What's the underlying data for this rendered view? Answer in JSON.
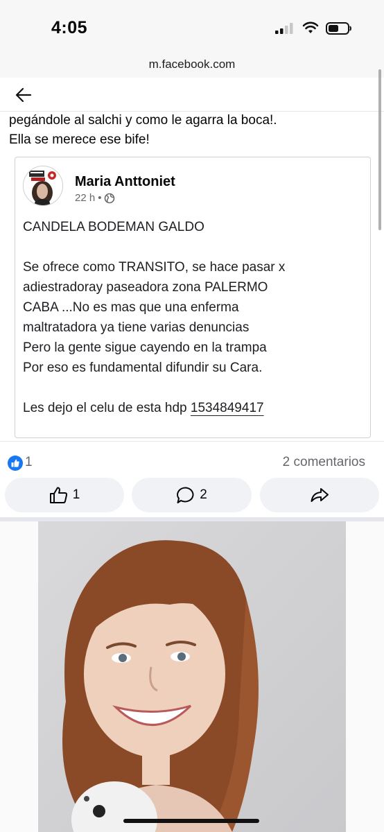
{
  "status_bar": {
    "time": "4:05"
  },
  "browser": {
    "url": "m.facebook.com"
  },
  "post": {
    "text_lines": [
      "pegándole al salchi y como le agarra la boca!.",
      "Ella se merece ese bife!"
    ]
  },
  "shared_post": {
    "author": "Maria Anttoniet",
    "time": "22 h",
    "separator": "•",
    "title": "CANDELA BODEMAN GALDO",
    "body_lines": [
      "Se ofrece como TRANSITO, se hace pasar x",
      "adiestradoray paseadora zona PALERMO",
      "CABA ...No es mas que una enferma",
      "maltratadora ya tiene varias denuncias",
      "Pero la gente sigue cayendo en la trampa",
      "Por eso es fundamental difundir su Cara."
    ],
    "closing_text": "Les dejo el celu de esta hdp ",
    "phone": "1534849417"
  },
  "reactions": {
    "like_count": "1",
    "comments": "2 comentarios"
  },
  "actions": {
    "like_count": "1",
    "comment_count": "2"
  },
  "colors": {
    "accent": "#1877f2",
    "button_bg": "#f0f2f5",
    "muted_text": "#65676b"
  }
}
